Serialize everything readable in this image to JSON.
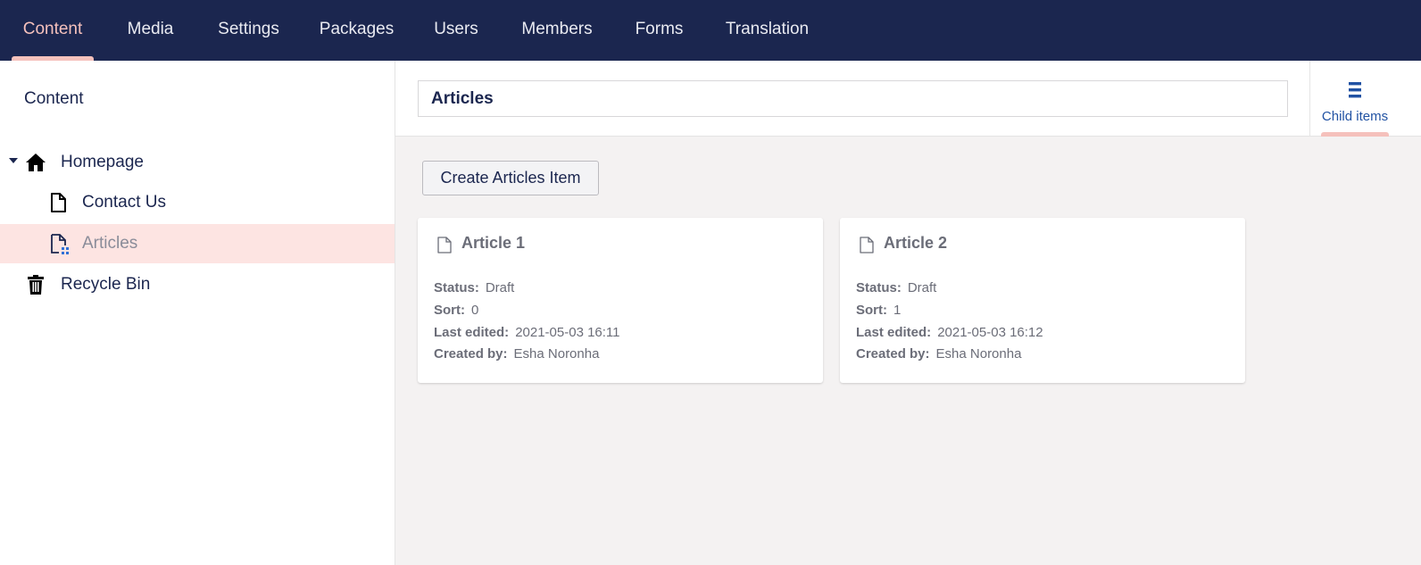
{
  "topnav": {
    "items": [
      {
        "label": "Content",
        "active": true
      },
      {
        "label": "Media"
      },
      {
        "label": "Settings"
      },
      {
        "label": "Packages"
      },
      {
        "label": "Users"
      },
      {
        "label": "Members"
      },
      {
        "label": "Forms"
      },
      {
        "label": "Translation"
      }
    ]
  },
  "sidebar": {
    "title": "Content",
    "tree": [
      {
        "label": "Homepage",
        "icon": "home-icon",
        "expanded": true
      },
      {
        "label": "Contact Us",
        "icon": "document-icon"
      },
      {
        "label": "Articles",
        "icon": "document-list-icon",
        "selected": true
      },
      {
        "label": "Recycle Bin",
        "icon": "trash-icon"
      }
    ]
  },
  "editor": {
    "name": "Articles",
    "apps": [
      {
        "label": "Child items",
        "icon": "list-icon",
        "active": true
      }
    ],
    "create_button": "Create Articles Item",
    "keys": {
      "status": "Status:",
      "sort": "Sort:",
      "last_edited": "Last edited:",
      "created_by": "Created by:"
    },
    "items": [
      {
        "title": "Article 1",
        "status": "Draft",
        "sort": "0",
        "last_edited": "2021-05-03 16:11",
        "created_by": "Esha Noronha"
      },
      {
        "title": "Article 2",
        "status": "Draft",
        "sort": "1",
        "last_edited": "2021-05-03 16:12",
        "created_by": "Esha Noronha"
      }
    ]
  },
  "colors": {
    "nav_bg": "#1b264f",
    "active_accent": "#f5c1bc",
    "selected_row": "#fde4e2",
    "main_bg": "#f4f2f2",
    "link_blue": "#2152a3"
  }
}
